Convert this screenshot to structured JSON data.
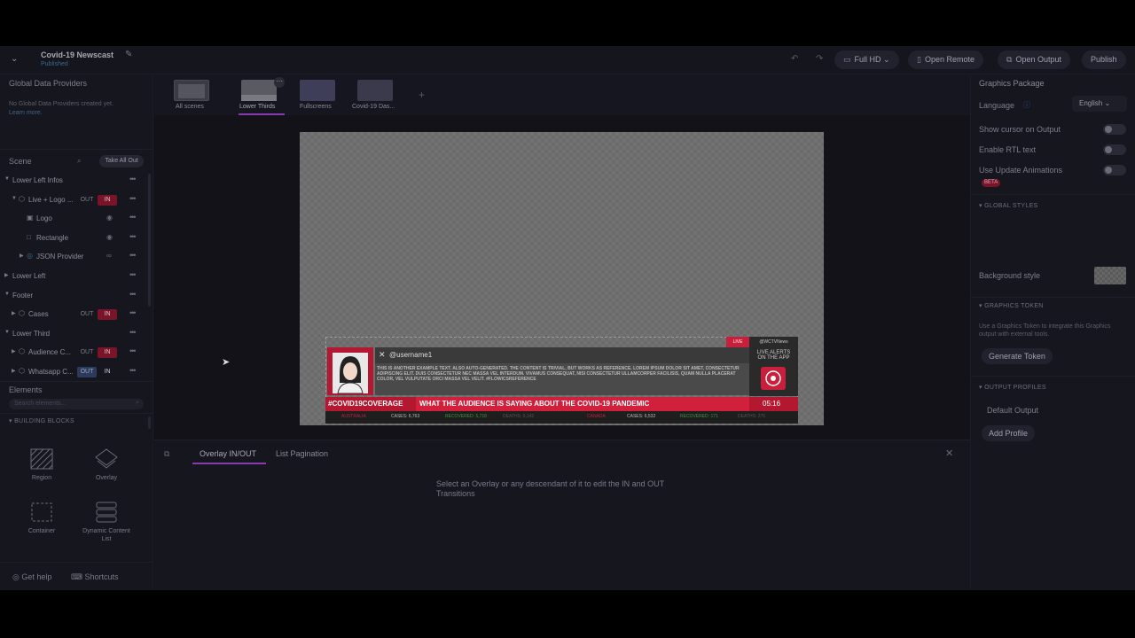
{
  "header": {
    "project_title": "Covid-19 Newscast",
    "project_status": "Published",
    "resolution_label": "Full HD",
    "open_remote_label": "Open Remote",
    "open_output_label": "Open Output",
    "publish_label": "Publish"
  },
  "left": {
    "global_title": "Global Data Providers",
    "global_note": "No Global Data Providers created yet.",
    "global_link": "Learn more.",
    "scene_label": "Scene",
    "take_all_out": "Take All Out",
    "scene_rows": [
      {
        "label": "Lower Left Infos"
      },
      {
        "label": "Live + Logo ...",
        "out": "OUT",
        "in": "IN"
      },
      {
        "label": "Logo"
      },
      {
        "label": "Rectangle"
      },
      {
        "label": "JSON Provider"
      },
      {
        "label": "Lower Left"
      },
      {
        "label": "Footer"
      },
      {
        "label": "Cases",
        "out": "OUT",
        "in": "IN"
      },
      {
        "label": "Lower Third"
      },
      {
        "label": "Audience C...",
        "out": "OUT",
        "in": "IN"
      },
      {
        "label": "Whatsapp C...",
        "out": "OUT",
        "in": "IN"
      }
    ],
    "elements_label": "Elements",
    "elements_search_placeholder": "Search elements...",
    "building_blocks": "BUILDING BLOCKS",
    "blocks": [
      {
        "label": "Region"
      },
      {
        "label": "Overlay"
      },
      {
        "label": "Container"
      },
      {
        "label": "Dynamic Content List"
      }
    ],
    "get_help": "Get help",
    "shortcuts": "Shortcuts"
  },
  "scenes": {
    "tabs": [
      {
        "label": "All scenes"
      },
      {
        "label": "Lower Thirds"
      },
      {
        "label": "Fullscreens"
      },
      {
        "label": "Covid-19 Das..."
      }
    ]
  },
  "lower_third": {
    "username": "@username1",
    "body_text": "THIS IS ANOTHER EXAMPLE TEXT. ALSO AUTO-GENERATED. THE CONTENT IS TRIVIAL, BUT WORKS AS REFERENCE. LOREM IPSUM DOLOR SIT AMET, CONSECTETUR ADIPISCING ELIT. DUIS CONSECTETUR NEC MASSA VEL INTERDUM. VIVAMUS CONSEQUAT, NISI CONSECTETUR ULLAMCORPER FACILISIS, QUAM NULLA PLACERAT COLOR, VEL VULPUTATE ORCI MASSA VEL VELIT. #FLOWICSREFERENCE",
    "live_badge": "LIVE",
    "handle": "@WCTVNews",
    "live_alerts": "LIVE ALERTS ON THE APP",
    "hashtag": "#COVID19COVERAGE",
    "headline": "WHAT THE AUDIENCE IS SAYING ABOUT THE COVID-19 PANDEMIC",
    "clock": "05:16",
    "ticker": [
      {
        "country": "AUSTRALIA",
        "cases": "CASES: 6,763",
        "recovered": "RECOVERED: 5,718",
        "deaths": "DEATHS: 6,142"
      },
      {
        "country": "CANADA",
        "cases": "CASES: 6,532",
        "recovered": "RECOVERED: 171",
        "deaths": "DEATHS: 275"
      }
    ]
  },
  "transitions": {
    "tab_overlay": "Overlay IN/OUT",
    "tab_pagination": "List Pagination",
    "message": "Select an Overlay or any descendant of it to edit the IN and OUT Transitions"
  },
  "right": {
    "title": "Graphics Package",
    "language_label": "Language",
    "language_value": "English",
    "show_cursor": "Show cursor on Output",
    "enable_rtl": "Enable RTL text",
    "update_animations": "Use Update Animations",
    "beta": "BETA",
    "global_styles": "GLOBAL STYLES",
    "background_style": "Background style",
    "graphics_token": "GRAPHICS TOKEN",
    "token_note": "Use a Graphics Token to integrate this Graphics output with external tools.",
    "generate_token": "Generate Token",
    "output_profiles": "OUTPUT PROFILES",
    "default_output": "Default Output",
    "add_profile": "Add Profile"
  },
  "colors": {
    "accent": "#8a3ab0",
    "live_red": "#c8203c",
    "dark_bg": "#14141c"
  }
}
